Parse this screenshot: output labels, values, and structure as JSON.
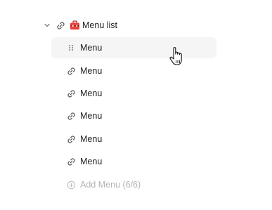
{
  "tree": {
    "parent": {
      "label": "Menu list",
      "expanded": true,
      "icons": [
        "chevron-down-icon",
        "link-icon",
        "toolbox-icon"
      ],
      "toolbox_color": "#e8403a"
    },
    "items": [
      {
        "label": "Menu",
        "icon": "drag-handle-icon",
        "hovered": true
      },
      {
        "label": "Menu",
        "icon": "link-icon"
      },
      {
        "label": "Menu",
        "icon": "link-icon"
      },
      {
        "label": "Menu",
        "icon": "link-icon"
      },
      {
        "label": "Menu",
        "icon": "link-icon"
      },
      {
        "label": "Menu",
        "icon": "link-icon"
      }
    ],
    "add_button": {
      "label": "Add Menu (6/6)",
      "icon": "plus-circle-icon",
      "disabled": true
    }
  },
  "colors": {
    "text": "#1f1f1f",
    "muted": "#b3b3b3",
    "hover_bg": "#f5f5f5",
    "icon": "#444444"
  }
}
